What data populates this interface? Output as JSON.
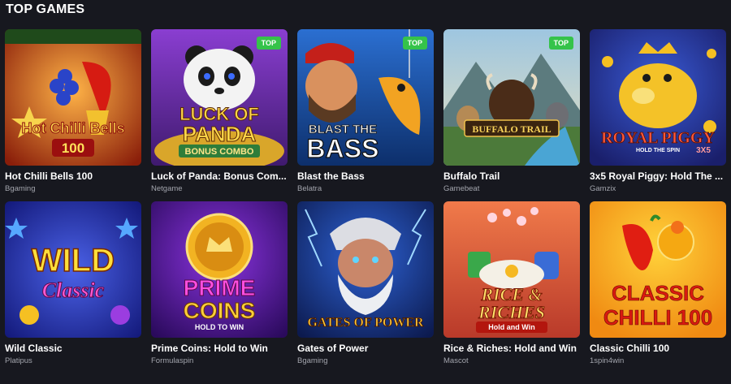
{
  "section": {
    "title": "TOP GAMES"
  },
  "badge_label": "TOP",
  "games": [
    {
      "title": "Hot Chilli Bells 100",
      "provider": "Bgaming",
      "art_lines": [
        "Hot Chilli Bells",
        "100"
      ]
    },
    {
      "title": "Luck of Panda: Bonus Com...",
      "provider": "Netgame",
      "art_lines": [
        "LUCK OF",
        "PANDA",
        "BONUS COMBO"
      ]
    },
    {
      "title": "Blast the Bass",
      "provider": "Belatra",
      "art_lines": [
        "BLAST THE",
        "BASS"
      ]
    },
    {
      "title": "Buffalo Trail",
      "provider": "Gamebeat",
      "art_lines": [
        "BUFFALO TRAIL"
      ]
    },
    {
      "title": "3x5 Royal Piggy: Hold The ...",
      "provider": "Gamzix",
      "art_lines": [
        "ROYAL PIGGY",
        "HOLD THE SPIN",
        "3X5"
      ]
    },
    {
      "title": "Wild Classic",
      "provider": "Platipus",
      "art_lines": [
        "WILD",
        "Classic"
      ]
    },
    {
      "title": "Prime Coins: Hold to Win",
      "provider": "Formulaspin",
      "art_lines": [
        "PRIME",
        "COINS",
        "HOLD TO WIN"
      ]
    },
    {
      "title": "Gates of Power",
      "provider": "Bgaming",
      "art_lines": [
        "GATES OF POWER"
      ]
    },
    {
      "title": "Rice & Riches: Hold and Win",
      "provider": "Mascot",
      "art_lines": [
        "RICE &",
        "RICHES",
        "Hold and Win"
      ]
    },
    {
      "title": "Classic Chilli 100",
      "provider": "1spin4win",
      "art_lines": [
        "CLASSIC",
        "CHILLI 100"
      ]
    }
  ]
}
